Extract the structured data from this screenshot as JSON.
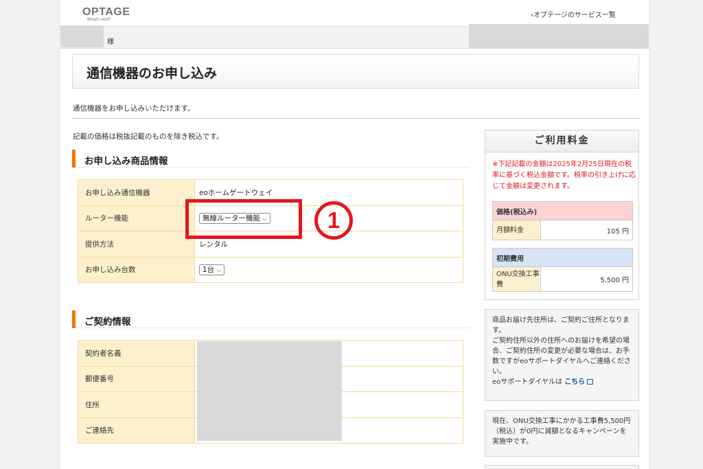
{
  "header": {
    "logo_text": "OPTAGE",
    "logo_tagline": "What's next?",
    "services_link": "›オプテージのサービス一覧",
    "user_suffix": "様"
  },
  "page": {
    "title": "通信機器のお申し込み",
    "intro": "通信機器をお申し込みいただけます。",
    "tax_note": "記載の価格は税抜記載のものを除き税込です。"
  },
  "product_section": {
    "heading": "お申し込み商品情報",
    "rows": [
      {
        "label": "お申し込み通信機器",
        "value": "eoホームゲートウェイ"
      },
      {
        "label": "ルーター機能",
        "select": "無線ルーター機能"
      },
      {
        "label": "提供方法",
        "value": "レンタル"
      },
      {
        "label": "お申し込み台数",
        "select": "1台"
      }
    ]
  },
  "annotation": {
    "number": "1"
  },
  "contract_section": {
    "heading": "ご契約情報",
    "rows": [
      {
        "label": "契約者名義"
      },
      {
        "label": "郵便番号"
      },
      {
        "label": "住所"
      },
      {
        "label": "ご連絡先"
      }
    ]
  },
  "fee": {
    "title": "ご利用料金",
    "note": "※下記記載の金額は2025年2月25日現在の税率に基づく税込金額です。税率の引き上げに応じて金額は変更されます。",
    "price_header": "価格(税込み)",
    "monthly_label": "月額料金",
    "monthly_value": "105 円",
    "initial_header": "初期費用",
    "onu_label": "ONU交換工事費",
    "onu_value": "5,500 円"
  },
  "delivery_info": {
    "text1": "商品お届け先住所は、ご契約ご住所となります。",
    "text2": "ご契約住所以外の住所へのお届けを希望の場合、ご契約住所の変更が必要な場合は、お手数ですがeoサポートダイヤルへご連絡ください。",
    "text3": "eoサポートダイヤルは",
    "link": "こちら"
  },
  "campaign_info": {
    "text": "現在、ONU交換工事にかかる工事費5,500円（税込）が0円に減額となるキャンペーンを実施中です。"
  },
  "colors": {
    "accent": "#ee7800",
    "annotation": "#e4161e",
    "label_bg": "#fdf1cd"
  }
}
